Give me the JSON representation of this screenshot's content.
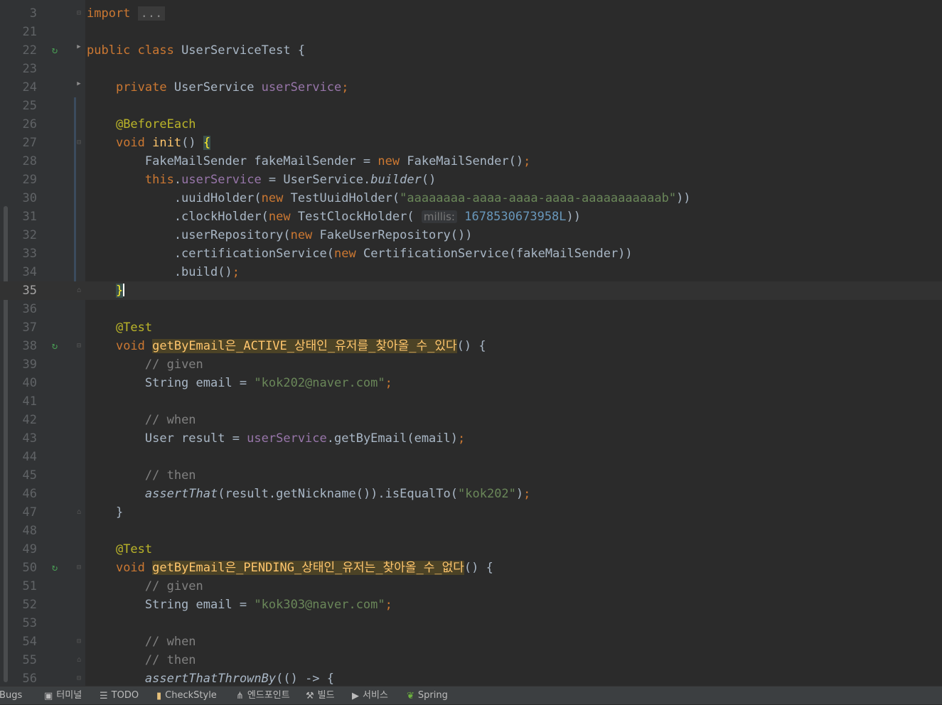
{
  "editor": {
    "lines": [
      {
        "ln": "3",
        "foldable": "open",
        "tokens": [
          [
            "kw",
            "import"
          ],
          [
            "plain",
            " "
          ],
          [
            "fold-text",
            "..."
          ]
        ]
      },
      {
        "ln": "21",
        "tokens": []
      },
      {
        "ln": "22",
        "run": true,
        "foldable": "arrow",
        "tokens": [
          [
            "kw",
            "public class "
          ],
          [
            "plain",
            "UserServiceTest {"
          ]
        ]
      },
      {
        "ln": "23",
        "tokens": []
      },
      {
        "ln": "24",
        "foldable": "arrow",
        "tokens": [
          [
            "plain",
            "    "
          ],
          [
            "kw",
            "private "
          ],
          [
            "plain",
            "UserService "
          ],
          [
            "fld",
            "userService"
          ],
          [
            "kw",
            ";"
          ]
        ]
      },
      {
        "ln": "25",
        "tokens": []
      },
      {
        "ln": "26",
        "tokens": [
          [
            "plain",
            "    "
          ],
          [
            "ann",
            "@BeforeEach"
          ]
        ]
      },
      {
        "ln": "27",
        "foldable": "open",
        "tokens": [
          [
            "plain",
            "    "
          ],
          [
            "kw",
            "void "
          ],
          [
            "fn",
            "init"
          ],
          [
            "plain",
            "() "
          ],
          [
            "brace",
            "{"
          ]
        ]
      },
      {
        "ln": "28",
        "tokens": [
          [
            "plain",
            "        FakeMailSender fakeMailSender = "
          ],
          [
            "kw",
            "new "
          ],
          [
            "plain",
            "FakeMailSender()"
          ],
          [
            "kw",
            ";"
          ]
        ]
      },
      {
        "ln": "29",
        "tokens": [
          [
            "plain",
            "        "
          ],
          [
            "kw",
            "this"
          ],
          [
            "plain",
            "."
          ],
          [
            "fld",
            "userService"
          ],
          [
            "plain",
            " = UserService."
          ],
          [
            "ital",
            "builder"
          ],
          [
            "plain",
            "()"
          ]
        ]
      },
      {
        "ln": "30",
        "tokens": [
          [
            "plain",
            "            .uuidHolder("
          ],
          [
            "kw",
            "new "
          ],
          [
            "plain",
            "TestUuidHolder("
          ],
          [
            "str",
            "\"aaaaaaaa-aaaa-aaaa-aaaa-aaaaaaaaaaab\""
          ],
          [
            "plain",
            "))"
          ]
        ]
      },
      {
        "ln": "31",
        "tokens": [
          [
            "plain",
            "            .clockHolder("
          ],
          [
            "kw",
            "new "
          ],
          [
            "plain",
            "TestClockHolder( "
          ],
          [
            "hint",
            "millis:"
          ],
          [
            "plain",
            " "
          ],
          [
            "num",
            "1678530673958L"
          ],
          [
            "plain",
            "))"
          ]
        ]
      },
      {
        "ln": "32",
        "tokens": [
          [
            "plain",
            "            .userRepository("
          ],
          [
            "kw",
            "new "
          ],
          [
            "plain",
            "FakeUserRepository())"
          ]
        ]
      },
      {
        "ln": "33",
        "tokens": [
          [
            "plain",
            "            .certificationService("
          ],
          [
            "kw",
            "new "
          ],
          [
            "plain",
            "CertificationService(fakeMailSender))"
          ]
        ]
      },
      {
        "ln": "34",
        "tokens": [
          [
            "plain",
            "            .build()"
          ],
          [
            "kw",
            ";"
          ]
        ]
      },
      {
        "ln": "35",
        "current": true,
        "foldable": "close",
        "tokens": [
          [
            "plain",
            "    "
          ],
          [
            "brace",
            "}"
          ],
          [
            "caret",
            ""
          ]
        ]
      },
      {
        "ln": "36",
        "tokens": []
      },
      {
        "ln": "37",
        "tokens": [
          [
            "plain",
            "    "
          ],
          [
            "ann",
            "@Test"
          ]
        ]
      },
      {
        "ln": "38",
        "run": true,
        "foldable": "open",
        "tokens": [
          [
            "plain",
            "    "
          ],
          [
            "kw",
            "void "
          ],
          [
            "hl",
            "getByEmail은_ACTIVE_상태인_유저를_찾아올_수_있다"
          ],
          [
            "plain",
            "() {"
          ]
        ]
      },
      {
        "ln": "39",
        "tokens": [
          [
            "plain",
            "        "
          ],
          [
            "com",
            "// given"
          ]
        ]
      },
      {
        "ln": "40",
        "tokens": [
          [
            "plain",
            "        String email = "
          ],
          [
            "str",
            "\"kok202@naver.com\""
          ],
          [
            "kw",
            ";"
          ]
        ]
      },
      {
        "ln": "41",
        "tokens": []
      },
      {
        "ln": "42",
        "tokens": [
          [
            "plain",
            "        "
          ],
          [
            "com",
            "// when"
          ]
        ]
      },
      {
        "ln": "43",
        "tokens": [
          [
            "plain",
            "        User result = "
          ],
          [
            "fld",
            "userService"
          ],
          [
            "plain",
            ".getByEmail(email)"
          ],
          [
            "kw",
            ";"
          ]
        ]
      },
      {
        "ln": "44",
        "tokens": []
      },
      {
        "ln": "45",
        "tokens": [
          [
            "plain",
            "        "
          ],
          [
            "com",
            "// then"
          ]
        ]
      },
      {
        "ln": "46",
        "tokens": [
          [
            "plain",
            "        "
          ],
          [
            "ital",
            "assertThat"
          ],
          [
            "plain",
            "(result.getNickname()).isEqualTo("
          ],
          [
            "str",
            "\"kok202\""
          ],
          [
            "plain",
            ")"
          ],
          [
            "kw",
            ";"
          ]
        ]
      },
      {
        "ln": "47",
        "foldable": "close",
        "tokens": [
          [
            "plain",
            "    }"
          ]
        ]
      },
      {
        "ln": "48",
        "tokens": []
      },
      {
        "ln": "49",
        "tokens": [
          [
            "plain",
            "    "
          ],
          [
            "ann",
            "@Test"
          ]
        ]
      },
      {
        "ln": "50",
        "run": true,
        "foldable": "open",
        "tokens": [
          [
            "plain",
            "    "
          ],
          [
            "kw",
            "void "
          ],
          [
            "hl",
            "getByEmail은_PENDING_상태인_유저는_찾아올_수_없다"
          ],
          [
            "plain",
            "() {"
          ]
        ]
      },
      {
        "ln": "51",
        "tokens": [
          [
            "plain",
            "        "
          ],
          [
            "com",
            "// given"
          ]
        ]
      },
      {
        "ln": "52",
        "tokens": [
          [
            "plain",
            "        String email = "
          ],
          [
            "str",
            "\"kok303@naver.com\""
          ],
          [
            "kw",
            ";"
          ]
        ]
      },
      {
        "ln": "53",
        "tokens": []
      },
      {
        "ln": "54",
        "foldable": "open",
        "tokens": [
          [
            "plain",
            "        "
          ],
          [
            "com",
            "// when"
          ]
        ]
      },
      {
        "ln": "55",
        "foldable": "close",
        "tokens": [
          [
            "plain",
            "        "
          ],
          [
            "com",
            "// then"
          ]
        ]
      },
      {
        "ln": "56",
        "foldable": "open",
        "tokens": [
          [
            "plain",
            "        "
          ],
          [
            "ital",
            "assertThatThrownBy"
          ],
          [
            "plain",
            "(() -> {"
          ]
        ]
      }
    ]
  },
  "statusbar": {
    "tool_windows": [
      {
        "label": "otBugs",
        "icon": "bug-icon"
      },
      {
        "label": "터미널",
        "icon": "terminal-icon"
      },
      {
        "label": "TODO",
        "icon": "list-icon"
      },
      {
        "label": "CheckStyle",
        "icon": "checkstyle-icon"
      },
      {
        "label": "엔드포인트",
        "icon": "endpoints-icon"
      },
      {
        "label": "빌드",
        "icon": "hammer-icon"
      },
      {
        "label": "서비스",
        "icon": "services-icon"
      },
      {
        "label": "Spring",
        "icon": "spring-icon"
      }
    ]
  },
  "colors": {
    "background": "#2b2b2b",
    "gutter": "#313335",
    "keyword": "#cc7832",
    "string": "#6a8759",
    "number": "#6897bb",
    "field": "#9876aa",
    "annotation": "#bbb529",
    "comment": "#808080",
    "method_highlight": "#ffc66d",
    "run_icon": "#499c54"
  }
}
